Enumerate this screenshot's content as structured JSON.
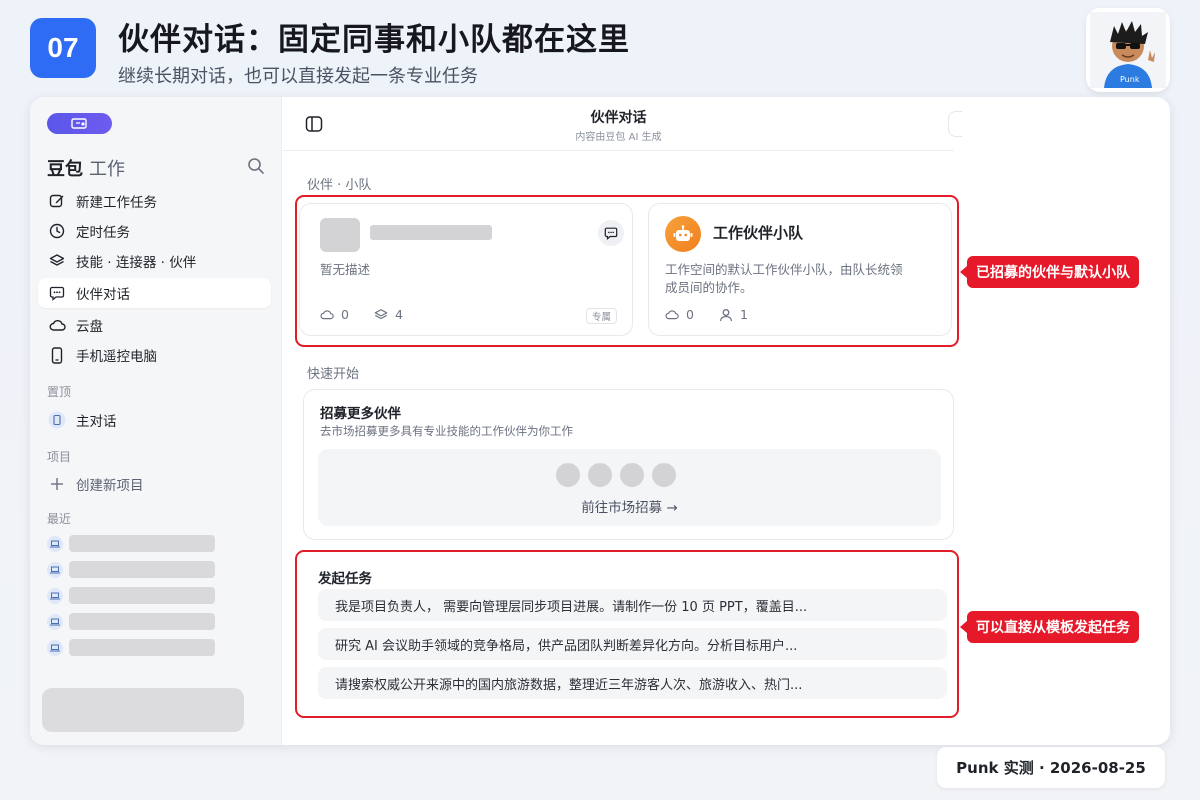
{
  "slide": {
    "number": "07",
    "headline": "伙伴对话：固定同事和小队都在这里",
    "subhead": "继续长期对话，也可以直接发起一条专业任务",
    "footer": "Punk 实测 · 2026-08-25"
  },
  "sidebar": {
    "brand": "豆包",
    "brand_suffix": "工作",
    "nav": [
      {
        "label": "新建工作任务",
        "icon": "edit-icon"
      },
      {
        "label": "定时任务",
        "icon": "clock-icon"
      },
      {
        "label": "技能 · 连接器 · 伙伴",
        "icon": "layers-icon"
      },
      {
        "label": "伙伴对话",
        "icon": "chat-bubble-icon",
        "active": true
      },
      {
        "label": "云盘",
        "icon": "cloud-icon"
      },
      {
        "label": "手机遥控电脑",
        "icon": "phone-icon"
      }
    ],
    "pinned_label": "置顶",
    "pinned_item": "主对话",
    "projects_label": "项目",
    "new_project": "创建新项目",
    "recent_label": "最近"
  },
  "topbar": {
    "title": "伙伴对话",
    "subtitle": "内容由豆包 AI 生成"
  },
  "partners": {
    "section_label": "伙伴 · 小队",
    "card1": {
      "desc": "暂无描述",
      "stat_a": "0",
      "stat_b": "4",
      "tag": "专属"
    },
    "card2": {
      "name": "工作伙伴小队",
      "desc_line1": "工作空间的默认工作伙伴小队，由队长统领",
      "desc_line2": "成员间的协作。",
      "stat_a": "0",
      "stat_b": "1"
    }
  },
  "quick_start": {
    "section_label": "快速开始",
    "recruit_title": "招募更多伙伴",
    "recruit_sub": "去市场招募更多具有专业技能的工作伙伴为你工作",
    "recruit_link": "前往市场招募 →"
  },
  "tasks": {
    "title": "发起任务",
    "items": [
      "我是项目负责人， 需要向管理层同步项目进展。请制作一份 10 页 PPT，覆盖目...",
      "研究 AI 会议助手领域的竞争格局，供产品团队判断差异化方向。分析目标用户...",
      "请搜索权威公开来源中的国内旅游数据，整理近三年游客人次、旅游收入、热门..."
    ]
  },
  "annotations": {
    "partners_callout": "已招募的伙伴与默认小队",
    "tasks_callout": "可以直接从模板发起任务",
    "highlight_color": "#e11d2a"
  },
  "colors": {
    "accent": "#2f6cf6",
    "callout": "#e6192a",
    "team_orange": "#f2891f",
    "pill_purple": "#5a57e8"
  }
}
